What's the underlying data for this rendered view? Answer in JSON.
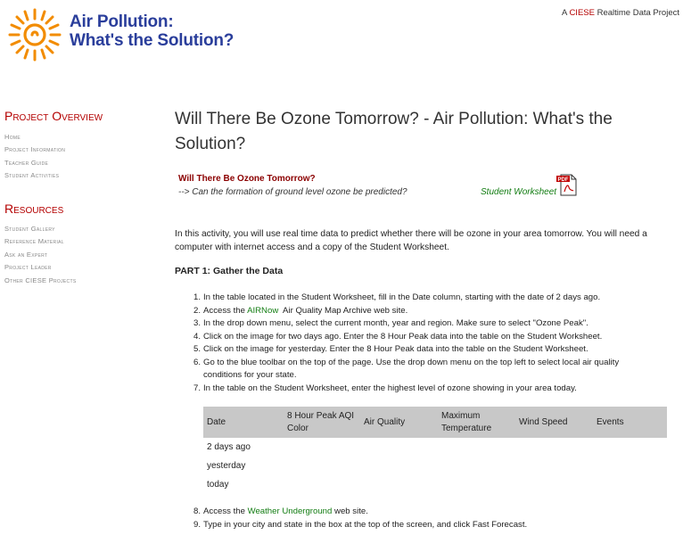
{
  "header": {
    "site_title_line1": "Air Pollution:",
    "site_title_line2": "What's the Solution?",
    "tagline_prefix": "A ",
    "tagline_brand": "CIESE",
    "tagline_suffix": " Realtime Data Project",
    "logo_icon": "sun-icon",
    "colors": {
      "title": "#2a3e9b",
      "logo": "#f28c00",
      "accent": "#b40000"
    }
  },
  "sidebar": {
    "project_heading": "Project Overview",
    "project_items": [
      "Home",
      "Project Information",
      "Teacher Guide",
      "Student Activities"
    ],
    "resources_heading": "Resources",
    "resources_items": [
      "Student Gallery",
      "Reference Material",
      "Ask an Expert",
      "Project Leader",
      "Other CIESE Projects"
    ]
  },
  "main": {
    "title": "Will There Be Ozone Tomorrow? - Air Pollution: What's the Solution?",
    "worksheet_title": "Will There Be Ozone Tomorrow?",
    "worksheet_subtitle": "--> Can the formation of ground level ozone be predicted?",
    "worksheet_link": "Student Worksheet",
    "pdf_icon": "pdf-file-icon",
    "intro": "In this activity, you will use real time data to predict whether there will be ozone in your area tomorrow. You will need a computer with internet access and a copy of the Student Worksheet.",
    "part1_heading": "PART 1: Gather the Data",
    "steps": [
      {
        "num": "1.",
        "text": "In the table located in the Student Worksheet, fill in the Date column, starting with the date of 2 days ago."
      },
      {
        "num": "2.",
        "pre": "Access the ",
        "link": "AIRNow",
        "post": "  Air Quality Map Archive web site."
      },
      {
        "num": "3.",
        "text": "In the drop down menu, select the current month, year and region. Make sure to select \"Ozone Peak\"."
      },
      {
        "num": "4.",
        "text": "Click on the image for two days ago. Enter the 8 Hour Peak data into the table on the Student Worksheet."
      },
      {
        "num": "5.",
        "text": "Click on the image for yesterday. Enter the 8 Hour Peak data into the table on the Student Worksheet."
      },
      {
        "num": "6.",
        "text": "Go to the blue toolbar on the top of the page. Use the drop down menu on the top left to select local air quality conditions for your state."
      },
      {
        "num": "7.",
        "text": "In the table on the Student Worksheet, enter the highest level of ozone showing in your area today."
      }
    ],
    "table": {
      "headers": [
        "Date",
        "8 Hour Peak AQI Color",
        "Air Quality",
        "Maximum Temperature",
        "Wind Speed",
        "Events"
      ],
      "rows": [
        "2 days ago",
        "yesterday",
        "today"
      ]
    },
    "steps_after": [
      {
        "num": "8.",
        "pre": "Access the ",
        "link": "Weather Underground",
        "post": " web site."
      },
      {
        "num": "9.",
        "text": "Type in your city and state in the box at the top of the screen, and click Fast Forecast."
      }
    ]
  }
}
